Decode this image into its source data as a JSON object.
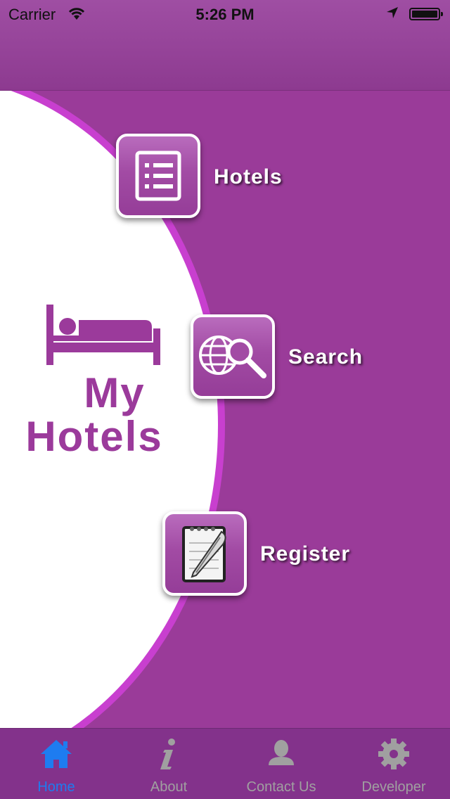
{
  "status_bar": {
    "carrier": "Carrier",
    "time": "5:26 PM"
  },
  "logo": {
    "line1": "My",
    "line2": "Hotels"
  },
  "menu": [
    {
      "id": "hotels",
      "label": "Hotels",
      "icon": "list-icon"
    },
    {
      "id": "search",
      "label": "Search",
      "icon": "globe-search-icon"
    },
    {
      "id": "register",
      "label": "Register",
      "icon": "notepad-pen-icon"
    }
  ],
  "tabs": [
    {
      "label": "Home",
      "icon": "home-icon",
      "active": true
    },
    {
      "label": "About",
      "icon": "info-icon",
      "active": false
    },
    {
      "label": "Contact Us",
      "icon": "person-icon",
      "active": false
    },
    {
      "label": "Developer",
      "icon": "gear-icon",
      "active": false
    }
  ],
  "colors": {
    "accent": "#9a3b99",
    "tab_active": "#1e7cf0",
    "arc_border": "#c83fcf"
  }
}
